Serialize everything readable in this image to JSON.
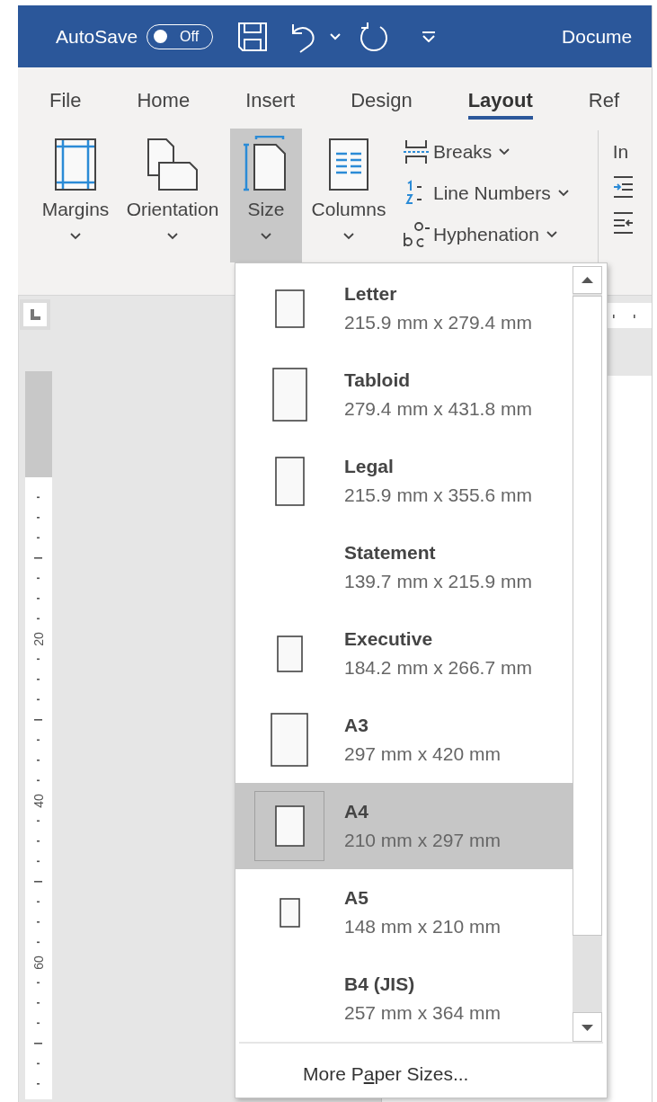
{
  "title_bar": {
    "autosave_label": "AutoSave",
    "autosave_toggle": {
      "label": "Off",
      "on": false
    },
    "document_title": "Docume"
  },
  "tabs": [
    {
      "label": "File",
      "selected": false
    },
    {
      "label": "Home",
      "selected": false
    },
    {
      "label": "Insert",
      "selected": false
    },
    {
      "label": "Design",
      "selected": false
    },
    {
      "label": "Layout",
      "selected": true
    },
    {
      "label": "Ref",
      "selected": false
    }
  ],
  "ribbon": {
    "large_buttons": [
      {
        "label": "Margins",
        "kind": "margins",
        "pressed": false
      },
      {
        "label": "Orientation",
        "kind": "orientation",
        "pressed": false
      },
      {
        "label": "Size",
        "kind": "size",
        "pressed": true
      },
      {
        "label": "Columns",
        "kind": "columns",
        "pressed": false
      }
    ],
    "small_buttons": [
      {
        "label": "Breaks",
        "kind": "breaks"
      },
      {
        "label": "Line Numbers",
        "kind": "line-numbers"
      },
      {
        "label": "Hyphenation",
        "kind": "hyphenation"
      }
    ],
    "next_group_label": "In"
  },
  "ruler": {
    "labels": [
      "20",
      "40",
      "60"
    ]
  },
  "size_menu": {
    "items": [
      {
        "name": "Letter",
        "dimensions": "215.9 mm x 279.4 mm",
        "icon": true,
        "selected": false
      },
      {
        "name": "Tabloid",
        "dimensions": "279.4 mm x 431.8 mm",
        "icon": true,
        "selected": false
      },
      {
        "name": "Legal",
        "dimensions": "215.9 mm x 355.6 mm",
        "icon": true,
        "selected": false
      },
      {
        "name": "Statement",
        "dimensions": "139.7 mm x 215.9 mm",
        "icon": false,
        "selected": false
      },
      {
        "name": "Executive",
        "dimensions": "184.2 mm x 266.7 mm",
        "icon": true,
        "selected": false
      },
      {
        "name": "A3",
        "dimensions": "297 mm x 420 mm",
        "icon": true,
        "selected": false
      },
      {
        "name": "A4",
        "dimensions": "210 mm x 297 mm",
        "icon": true,
        "selected": true
      },
      {
        "name": "A5",
        "dimensions": "148 mm x 210 mm",
        "icon": true,
        "selected": false
      },
      {
        "name": "B4 (JIS)",
        "dimensions": "257 mm x 364 mm",
        "icon": false,
        "selected": false
      }
    ],
    "more": {
      "before": "More P",
      "access_key": "a",
      "after": "per Sizes..."
    }
  }
}
